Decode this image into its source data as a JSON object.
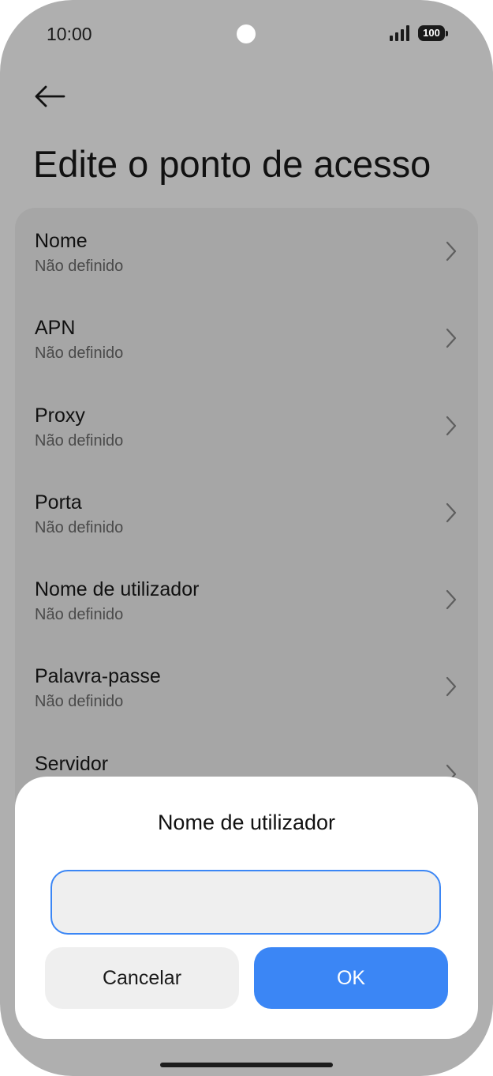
{
  "status_bar": {
    "time": "10:00",
    "battery": "100"
  },
  "header": {
    "back_icon": "arrow-left-icon",
    "title": "Edite o ponto de acesso"
  },
  "settings": {
    "items": [
      {
        "title": "Nome",
        "value": "Não definido"
      },
      {
        "title": "APN",
        "value": "Não definido"
      },
      {
        "title": "Proxy",
        "value": "Não definido"
      },
      {
        "title": "Porta",
        "value": "Não definido"
      },
      {
        "title": "Nome de utilizador",
        "value": "Não definido"
      },
      {
        "title": "Palavra-passe",
        "value": "Não definido"
      },
      {
        "title": "Servidor",
        "value": ""
      }
    ]
  },
  "dialog": {
    "title": "Nome de utilizador",
    "input_value": "",
    "cancel_label": "Cancelar",
    "ok_label": "OK"
  },
  "colors": {
    "accent": "#3b86f5",
    "scrim_background": "#afafaf",
    "dialog_background": "#ffffff"
  }
}
